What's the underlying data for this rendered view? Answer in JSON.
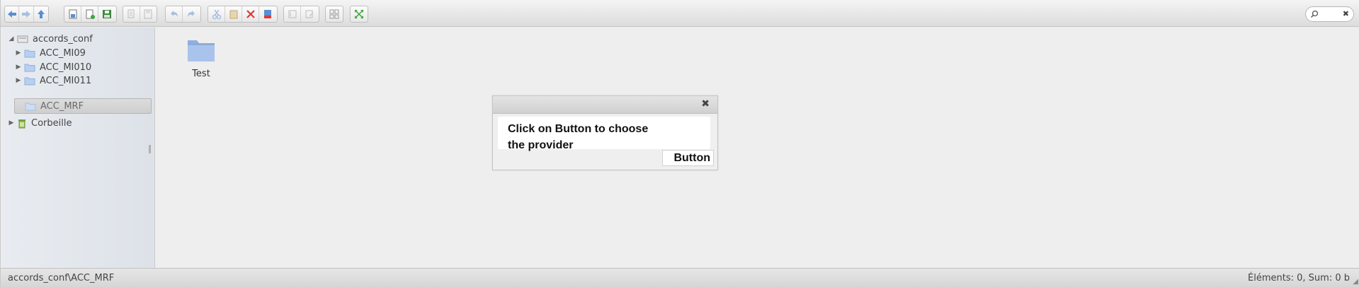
{
  "toolbar": {
    "groups": [
      [
        "back-icon",
        "forward-icon",
        "up-icon"
      ],
      [
        "open-icon",
        "new-file-icon",
        "save-icon"
      ],
      [
        "copy-disabled-icon",
        "save-disabled-icon"
      ],
      [
        "undo-icon",
        "redo-icon"
      ],
      [
        "cut-icon",
        "paste-icon",
        "delete-icon",
        "rename-icon"
      ],
      [
        "info-icon",
        "edit-icon"
      ],
      [
        "view-icons-icon"
      ],
      [
        "fullscreen-icon"
      ]
    ]
  },
  "search": {
    "placeholder": "",
    "value": ""
  },
  "sidebar": {
    "root": {
      "label": "accords_conf",
      "expanded": true
    },
    "items": [
      {
        "label": "ACC_MI09",
        "expandable": true
      },
      {
        "label": "ACC_MI010",
        "expandable": true
      },
      {
        "label": "ACC_MI011",
        "expandable": true
      },
      {
        "label": "ACC_MRF",
        "expandable": false,
        "selected": true
      }
    ],
    "trash": {
      "label": "Corbeille",
      "expandable": true
    }
  },
  "main": {
    "items": [
      {
        "label": "Test",
        "type": "folder"
      }
    ]
  },
  "dialog": {
    "message": "Click on Button to choose the provider",
    "button_label": "Button"
  },
  "status": {
    "path": "accords_conf\\ACC_MRF",
    "info": "Éléments: 0, Sum: 0 b"
  },
  "colors": {
    "folder_blue": "#8fb0e0",
    "trash_green": "#7aa63a",
    "delete_red": "#d83a3a",
    "fullscreen_green": "#3aa63a"
  }
}
